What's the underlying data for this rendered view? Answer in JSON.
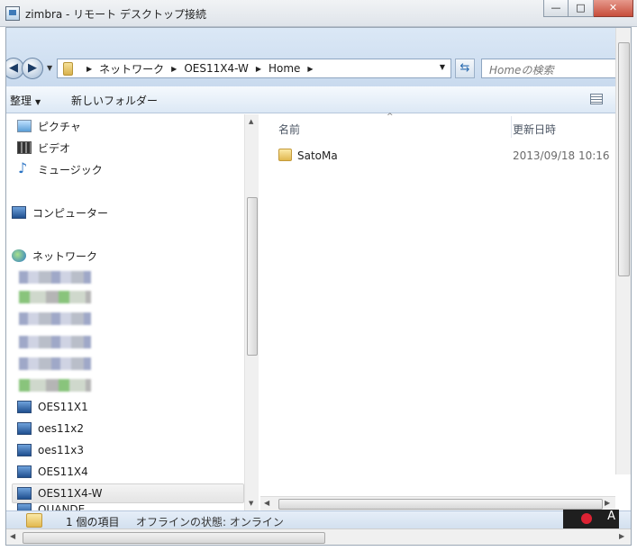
{
  "window": {
    "title": "zimbra - リモート デスクトップ接続",
    "buttons": {
      "minimize": "—",
      "maximize": "□",
      "close": "✕"
    }
  },
  "address_bar": {
    "breadcrumbs": [
      "ネットワーク",
      "OES11X4-W",
      "Home"
    ],
    "search_placeholder": "Homeの検索"
  },
  "toolbar": {
    "organize": "整理",
    "new_folder": "新しいフォルダー"
  },
  "nav_pane": {
    "libraries": [
      {
        "label": "ピクチャ",
        "icon": "pictures-icon"
      },
      {
        "label": "ビデオ",
        "icon": "video-icon"
      },
      {
        "label": "ミュージック",
        "icon": "music-icon"
      }
    ],
    "computer": "コンピューター",
    "network": "ネットワーク",
    "network_items": [
      "OES11X1",
      "oes11x2",
      "oes11x3",
      "OES11X4",
      "OES11X4-W",
      "OUANDE"
    ],
    "selected_item": "OES11X4-W"
  },
  "content": {
    "columns": {
      "name": "名前",
      "modified": "更新日時"
    },
    "files": [
      {
        "name": "SatoMa",
        "modified": "2013/09/18 10:16",
        "icon": "folder-icon"
      }
    ]
  },
  "status_bar": {
    "item_count": "1 個の項目",
    "offline_status": "オフラインの状態: オンライン",
    "ime_indicator": "A"
  }
}
